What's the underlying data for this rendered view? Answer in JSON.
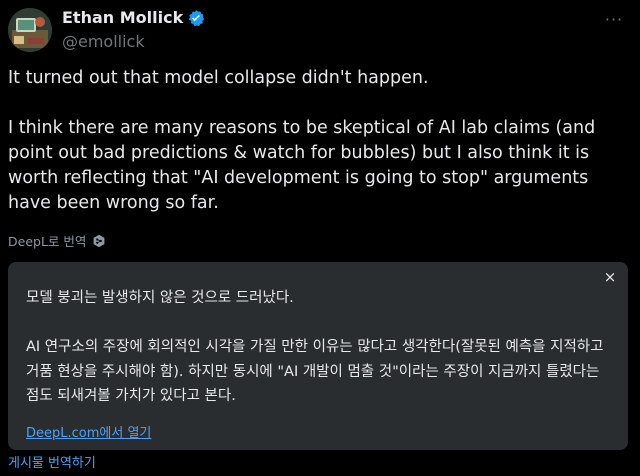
{
  "author": {
    "display_name": "Ethan Mollick",
    "handle": "@emollick",
    "verified": true,
    "verified_badge_color": "#1d9bf0"
  },
  "menu": {
    "more_icon": "ellipsis-icon",
    "more_label": "···"
  },
  "tweet": {
    "paragraphs": [
      "It turned out that model collapse didn't happen.",
      "I think there are many reasons to be skeptical of AI lab claims (and point out bad predictions & watch for bubbles) but I also think it is worth reflecting that \"AI development is going to stop\" arguments have been wrong so far."
    ]
  },
  "translation": {
    "attribution_label": "DeepL로 번역",
    "card": {
      "close_label": "×",
      "paragraphs": [
        "모델 붕괴는 발생하지 않은 것으로 드러났다.",
        "AI 연구소의 주장에 회의적인 시각을 가질 만한 이유는 많다고 생각한다(잘못된 예측을 지적하고 거품 현상을 주시해야 함). 하지만 동시에 \"AI 개발이 멈출 것\"이라는 주장이 지금까지 틀렸다는 점도 되새겨볼 가치가 있다고 본다."
      ],
      "open_link_label": "DeepL.com에서 열기"
    },
    "translate_post_label": "게시물 번역하기"
  },
  "colors": {
    "background": "#000000",
    "text": "#e7e9ea",
    "muted": "#71767b",
    "card_bg": "#2a2d30",
    "link": "#4ea1f3"
  }
}
